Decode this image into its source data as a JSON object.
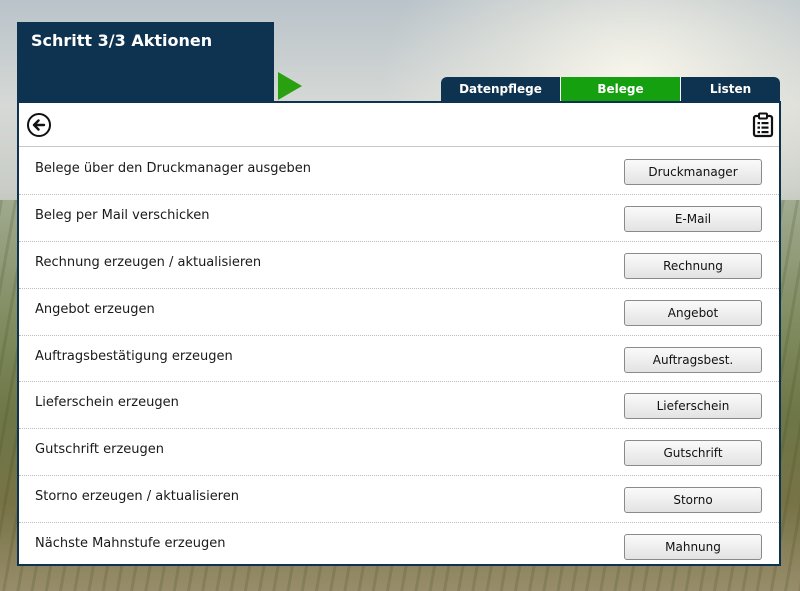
{
  "header": {
    "step_title": "Schritt 3/3 Aktionen"
  },
  "tabs": [
    {
      "label": "Datenpflege",
      "active": false
    },
    {
      "label": "Belege",
      "active": true
    },
    {
      "label": "Listen",
      "active": false
    }
  ],
  "colors": {
    "primary": "#0e3350",
    "active_tab": "#15a010",
    "play_arrow": "#28a010"
  },
  "toolbar": {
    "back_icon": "back-arrow-circle-icon",
    "clipboard_icon": "clipboard-list-icon"
  },
  "actions": [
    {
      "label": "Belege über den Druckmanager ausgeben",
      "button": "Druckmanager"
    },
    {
      "label": "Beleg per Mail verschicken",
      "button": "E-Mail"
    },
    {
      "label": "Rechnung erzeugen / aktualisieren",
      "button": "Rechnung"
    },
    {
      "label": "Angebot erzeugen",
      "button": "Angebot"
    },
    {
      "label": "Auftragsbestätigung erzeugen",
      "button": "Auftragsbest."
    },
    {
      "label": "Lieferschein erzeugen",
      "button": "Lieferschein"
    },
    {
      "label": "Gutschrift erzeugen",
      "button": "Gutschrift"
    },
    {
      "label": "Storno erzeugen / aktualisieren",
      "button": "Storno"
    },
    {
      "label": "Nächste Mahnstufe erzeugen",
      "button": "Mahnung"
    }
  ]
}
